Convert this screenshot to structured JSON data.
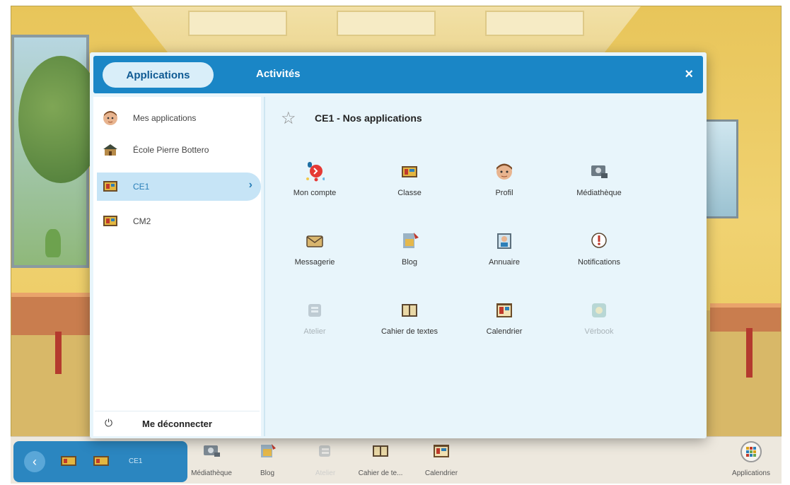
{
  "modal": {
    "tabs": [
      {
        "label": "Applications",
        "active": true
      },
      {
        "label": "Activités",
        "active": false
      }
    ],
    "close_label": "×"
  },
  "sidebar": {
    "items": [
      {
        "label": "Mes applications",
        "icon": "avatar-icon"
      },
      {
        "label": "École Pierre Bottero",
        "icon": "school-icon"
      },
      {
        "label": "CE1",
        "icon": "classroom-icon",
        "active": true
      },
      {
        "label": "CM2",
        "icon": "classroom-icon"
      }
    ],
    "logout_label": "Me déconnecter",
    "logout_icon": "power-icon"
  },
  "content": {
    "title": "CE1 - Nos applications",
    "apps": [
      {
        "label": "Mon compte",
        "icon": "account-icon",
        "enabled": true
      },
      {
        "label": "Classe",
        "icon": "classroom-icon",
        "enabled": true
      },
      {
        "label": "Profil",
        "icon": "avatar-icon",
        "enabled": true
      },
      {
        "label": "Médiathèque",
        "icon": "media-library-icon",
        "enabled": true
      },
      {
        "label": "Messagerie",
        "icon": "envelope-icon",
        "enabled": true
      },
      {
        "label": "Blog",
        "icon": "blog-icon",
        "enabled": true
      },
      {
        "label": "Annuaire",
        "icon": "directory-icon",
        "enabled": true
      },
      {
        "label": "Notifications",
        "icon": "notification-icon",
        "enabled": true
      },
      {
        "label": "Atelier",
        "icon": "workshop-icon",
        "enabled": false
      },
      {
        "label": "Cahier de textes",
        "icon": "textbook-icon",
        "enabled": true
      },
      {
        "label": "Calendrier",
        "icon": "calendar-icon",
        "enabled": true
      },
      {
        "label": "Vërbook",
        "icon": "verbook-icon",
        "enabled": false
      }
    ]
  },
  "bottombar": {
    "class_label": "CE1",
    "items": [
      {
        "label": "Médiathèque",
        "enabled": true
      },
      {
        "label": "Blog",
        "enabled": true
      },
      {
        "label": "Atelier",
        "enabled": false
      },
      {
        "label": "Cahier de te...",
        "enabled": true
      },
      {
        "label": "Calendrier",
        "enabled": true
      }
    ],
    "apps_label": "Applications"
  },
  "colors": {
    "header_blue": "#1a86c6",
    "modal_bg": "#e8f5fb",
    "active_item_bg": "#c6e4f6"
  }
}
